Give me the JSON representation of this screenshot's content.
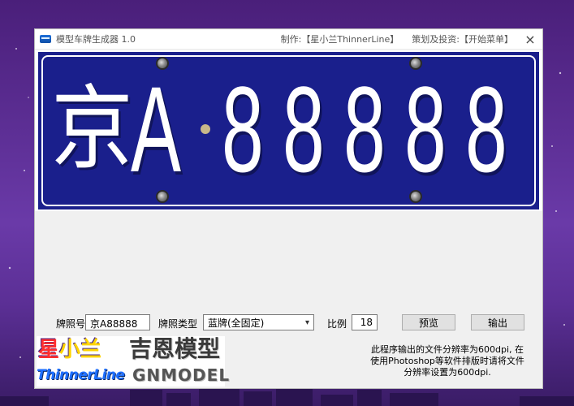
{
  "window": {
    "title": "模型车牌生成器 1.0",
    "credit": "制作:【星小兰ThinnerLine】",
    "sponsor": "策划及投资:【开始菜单】",
    "close_glyph": "×"
  },
  "plate": {
    "province": "京",
    "letter": "A",
    "digits": [
      "8",
      "8",
      "8",
      "8",
      "8"
    ],
    "background_color": "#1a1f8c"
  },
  "form": {
    "plate_number_label": "牌照号",
    "plate_number_value": "京A88888",
    "plate_type_label": "牌照类型",
    "plate_type_value": "蓝牌(全固定)",
    "scale_label": "比例",
    "scale_value": "18",
    "preview_button": "预览",
    "output_button": "输出"
  },
  "logos": {
    "xing_part1": "星",
    "xing_part2": "小兰",
    "thinnerline": "ThinnerLine",
    "jien": "吉恩模型",
    "gnmodel": "GNMODEL"
  },
  "note": {
    "line1": "此程序输出的文件分辨率为600dpi, 在",
    "line2": "使用Photoshop等软件排版时请将文件",
    "line3": "分辨率设置为600dpi."
  }
}
